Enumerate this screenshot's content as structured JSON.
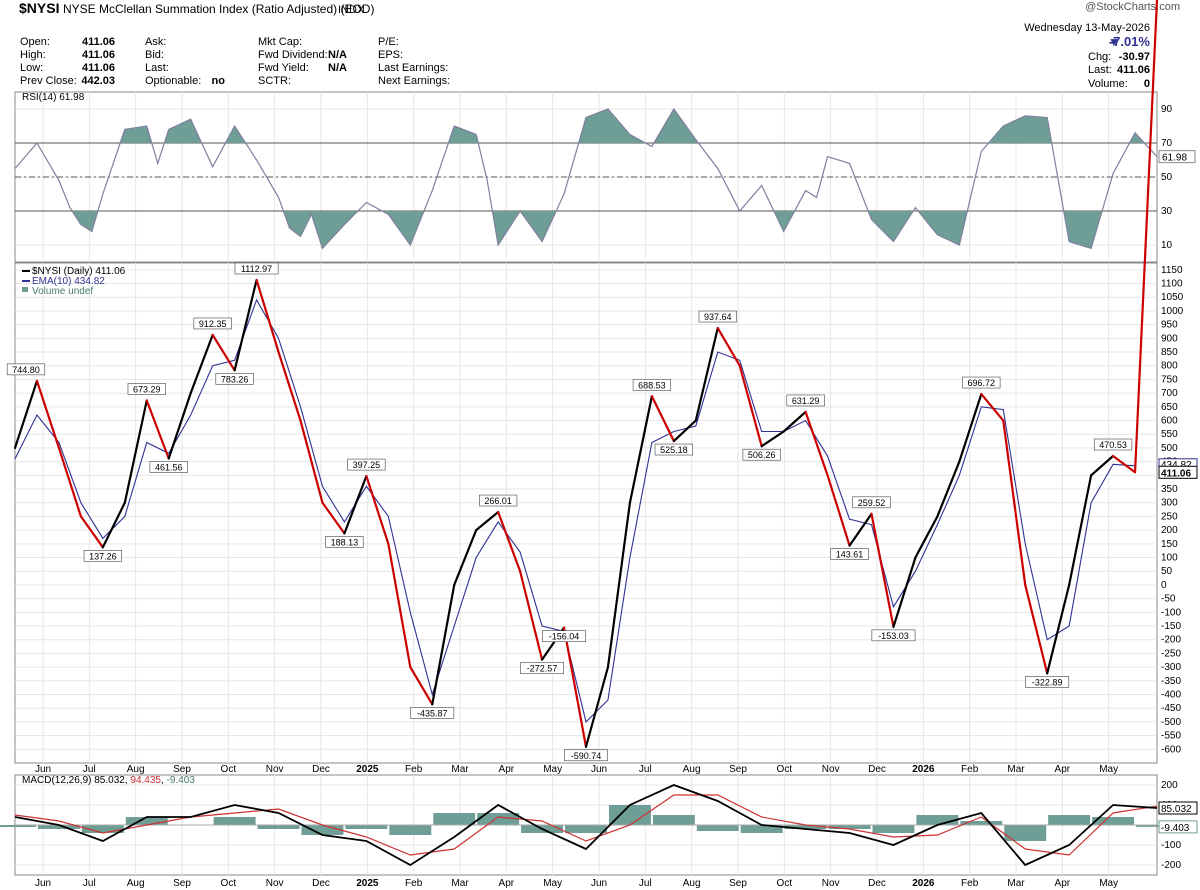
{
  "header": {
    "symbol": "$NYSI",
    "name": "NYSE McClellan Summation Index (Ratio Adjusted) (EOD)",
    "exchange": "INDX",
    "watermark": "@StockCharts.com",
    "date": "Wednesday  13-May-2026",
    "change_pct": "-7.01%",
    "chg_label": "Chg:",
    "chg_value": "-30.97",
    "last_label": "Last:",
    "last_value": "411.06",
    "volume_label": "Volume:",
    "volume_value": "0",
    "quote_rows": [
      [
        {
          "label": "Open:",
          "value": "411.06"
        },
        {
          "label": "Ask:",
          "value": ""
        },
        {
          "label": "Mkt Cap:",
          "value": ""
        },
        {
          "label": "P/E:",
          "value": ""
        }
      ],
      [
        {
          "label": "High:",
          "value": "411.06"
        },
        {
          "label": "Bid:",
          "value": ""
        },
        {
          "label": "Fwd Dividend:",
          "value": "N/A"
        },
        {
          "label": "EPS:",
          "value": ""
        }
      ],
      [
        {
          "label": "Low:",
          "value": "411.06"
        },
        {
          "label": "Last:",
          "value": ""
        },
        {
          "label": "Fwd Yield:",
          "value": "N/A"
        },
        {
          "label": "Last Earnings:",
          "value": ""
        }
      ],
      [
        {
          "label": "Prev Close:",
          "value": "442.03"
        },
        {
          "label": "Optionable:",
          "value": "no"
        },
        {
          "label": "SCTR:",
          "value": ""
        },
        {
          "label": "Next Earnings:",
          "value": ""
        }
      ]
    ]
  },
  "colors": {
    "up": "#000000",
    "down": "#cc0000",
    "ema": "#2e3192",
    "rsi_line": "#7f7f9f",
    "rsi_fill": "#6e9e96",
    "macd_line": "#000000",
    "signal_line": "#cc3333",
    "hist": "#6e9e96",
    "grid": "#e6e6e6"
  },
  "chart_data": [
    {
      "type": "line",
      "panel": "RSI",
      "title": "RSI(14) 61.98",
      "last_value_label": "61.98",
      "ylim": [
        0,
        100
      ],
      "ticks": [
        10,
        30,
        50,
        70,
        90
      ],
      "overbought": 70,
      "oversold": 30,
      "x": [
        0,
        2,
        4,
        5,
        6,
        7,
        8,
        10,
        12,
        13,
        14,
        16,
        18,
        20,
        22,
        24,
        25,
        26,
        27,
        28,
        30,
        32,
        34,
        36,
        38,
        40,
        42,
        43,
        44,
        46,
        48,
        50,
        52,
        54,
        56,
        58,
        60,
        62,
        64,
        66,
        68,
        70,
        72,
        73,
        74,
        76,
        78,
        80,
        82,
        84,
        86,
        88,
        90,
        92,
        94,
        96,
        98,
        100,
        102,
        104
      ],
      "values": [
        55,
        70,
        48,
        32,
        22,
        18,
        40,
        78,
        80,
        58,
        78,
        84,
        56,
        80,
        60,
        38,
        20,
        15,
        28,
        8,
        22,
        35,
        28,
        10,
        42,
        80,
        75,
        48,
        10,
        30,
        12,
        40,
        85,
        90,
        75,
        68,
        90,
        72,
        55,
        30,
        45,
        18,
        42,
        38,
        62,
        58,
        25,
        12,
        32,
        16,
        10,
        65,
        80,
        86,
        85,
        12,
        8,
        52,
        76,
        61.98
      ]
    },
    {
      "type": "line",
      "panel": "price",
      "title": "$NYSI (Daily) 411.06",
      "series": [
        {
          "name": "$NYSI (Daily) 411.06",
          "values_ref": "x/y"
        },
        {
          "name": "EMA(10) 434.82"
        },
        {
          "name": "Volume undef"
        }
      ],
      "ylim": [
        -650,
        1175
      ],
      "yticks": [
        -600,
        -550,
        -500,
        -450,
        -400,
        -350,
        -300,
        -250,
        -200,
        -150,
        -100,
        -50,
        0,
        50,
        100,
        150,
        200,
        250,
        300,
        350,
        400,
        450,
        500,
        550,
        600,
        650,
        700,
        750,
        800,
        850,
        900,
        950,
        1000,
        1050,
        1100,
        1150
      ],
      "x_labels": [
        "Jun",
        "Jul",
        "Aug",
        "Sep",
        "Oct",
        "Nov",
        "Dec",
        "2025",
        "Feb",
        "Mar",
        "Apr",
        "May",
        "Jun",
        "Jul",
        "Aug",
        "Sep",
        "Oct",
        "Nov",
        "Dec",
        "2026",
        "Feb",
        "Mar",
        "Apr",
        "May"
      ],
      "x": [
        0,
        2,
        4,
        6,
        8,
        10,
        12,
        14,
        16,
        18,
        20,
        22,
        24,
        26,
        28,
        30,
        32,
        34,
        36,
        38,
        40,
        42,
        44,
        46,
        48,
        50,
        52,
        54,
        56,
        58,
        60,
        62,
        64,
        66,
        68,
        70,
        72,
        74,
        76,
        78,
        80,
        82,
        84,
        86,
        88,
        90,
        92,
        94,
        96,
        98,
        100,
        102,
        104
      ],
      "values": [
        500,
        744.8,
        500,
        250,
        137.26,
        300,
        673.29,
        461.56,
        700,
        912.35,
        783.26,
        1112.97,
        850,
        600,
        300,
        188.13,
        397.25,
        150,
        -300,
        -435.87,
        0,
        200,
        266.01,
        50,
        -272.57,
        -156.04,
        -590.74,
        -300,
        300,
        688.53,
        525.18,
        600,
        937.64,
        800,
        506.26,
        560,
        631.29,
        400,
        143.61,
        259.52,
        -153.03,
        100,
        250,
        450,
        696.72,
        600,
        0,
        -322.89,
        0,
        400,
        470.53,
        411.06
      ],
      "ema": [
        460,
        620,
        520,
        300,
        170,
        250,
        520,
        480,
        620,
        800,
        820,
        1040,
        900,
        650,
        360,
        230,
        360,
        250,
        -100,
        -400,
        -150,
        100,
        230,
        120,
        -150,
        -170,
        -500,
        -420,
        100,
        520,
        560,
        580,
        850,
        820,
        560,
        560,
        600,
        470,
        240,
        220,
        -80,
        50,
        220,
        400,
        650,
        640,
        150,
        -200,
        -150,
        300,
        440,
        434.82
      ],
      "annotations": [
        {
          "label": "744.80",
          "x": 1,
          "y": 744.8
        },
        {
          "label": "137.26",
          "x": 8,
          "y": 137.26
        },
        {
          "label": "673.29",
          "x": 12,
          "y": 673.29
        },
        {
          "label": "461.56",
          "x": 14,
          "y": 461.56
        },
        {
          "label": "912.35",
          "x": 18,
          "y": 912.35
        },
        {
          "label": "783.26",
          "x": 20,
          "y": 783.26
        },
        {
          "label": "1112.97",
          "x": 22,
          "y": 1112.97
        },
        {
          "label": "188.13",
          "x": 30,
          "y": 188.13
        },
        {
          "label": "397.25",
          "x": 32,
          "y": 397.25
        },
        {
          "label": "-435.87",
          "x": 38,
          "y": -435.87
        },
        {
          "label": "266.01",
          "x": 44,
          "y": 266.01
        },
        {
          "label": "-272.57",
          "x": 48,
          "y": -272.57
        },
        {
          "label": "-156.04",
          "x": 50,
          "y": -156.04
        },
        {
          "label": "-590.74",
          "x": 52,
          "y": -590.74
        },
        {
          "label": "688.53",
          "x": 58,
          "y": 688.53
        },
        {
          "label": "525.18",
          "x": 60,
          "y": 525.18
        },
        {
          "label": "937.64",
          "x": 64,
          "y": 937.64
        },
        {
          "label": "506.26",
          "x": 68,
          "y": 506.26
        },
        {
          "label": "631.29",
          "x": 72,
          "y": 631.29
        },
        {
          "label": "143.61",
          "x": 76,
          "y": 143.61
        },
        {
          "label": "259.52",
          "x": 78,
          "y": 259.52
        },
        {
          "label": "-153.03",
          "x": 80,
          "y": -153.03
        },
        {
          "label": "696.72",
          "x": 88,
          "y": 696.72
        },
        {
          "label": "-322.89",
          "x": 94,
          "y": -322.89
        },
        {
          "label": "470.53",
          "x": 100,
          "y": 470.53
        }
      ],
      "last_labels": [
        "434.82",
        "411.06"
      ]
    },
    {
      "type": "line",
      "panel": "MACD",
      "title": "MACD(12,26,9) 85.032, 94.435, -9.403",
      "title_parts": [
        "MACD(12,26,9) ",
        "85.032",
        ", ",
        "94.435",
        ", ",
        "-9.403"
      ],
      "ylim": [
        -250,
        250
      ],
      "yticks": [
        -200,
        -100,
        100,
        200
      ],
      "last_labels": [
        "85.032",
        "-9.403"
      ],
      "x": [
        0,
        4,
        8,
        12,
        16,
        20,
        24,
        28,
        32,
        36,
        40,
        44,
        48,
        52,
        56,
        60,
        64,
        68,
        72,
        76,
        80,
        84,
        88,
        92,
        96,
        100,
        104
      ],
      "macd": [
        40,
        0,
        -80,
        40,
        40,
        100,
        60,
        -50,
        -80,
        -200,
        -60,
        100,
        -20,
        -120,
        100,
        200,
        120,
        0,
        -20,
        -40,
        -100,
        0,
        60,
        -200,
        -100,
        100,
        85.032
      ],
      "signal": [
        50,
        20,
        -40,
        0,
        40,
        60,
        80,
        0,
        -60,
        -150,
        -120,
        40,
        20,
        -80,
        0,
        150,
        150,
        40,
        0,
        -20,
        -60,
        -50,
        40,
        -120,
        -150,
        60,
        94.435
      ],
      "histogram": [
        -10,
        -20,
        -40,
        40,
        0,
        40,
        -20,
        -50,
        -20,
        -50,
        60,
        60,
        -40,
        -40,
        100,
        50,
        -30,
        -40,
        -20,
        -20,
        -40,
        50,
        20,
        -80,
        50,
        40,
        -9.403
      ]
    }
  ]
}
